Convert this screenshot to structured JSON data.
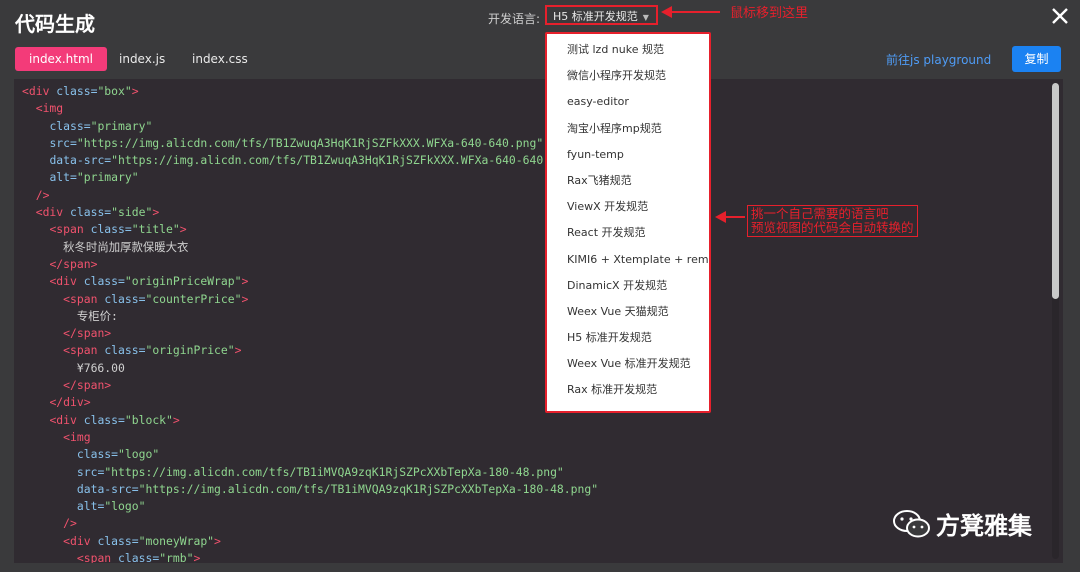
{
  "header": {
    "title": "代码生成",
    "lang_label": "开发语言:",
    "lang_selected": "H5 标准开发规范"
  },
  "tabs": [
    {
      "label": "index.html",
      "active": true
    },
    {
      "label": "index.js",
      "active": false
    },
    {
      "label": "index.css",
      "active": false
    }
  ],
  "toolbar": {
    "playground_label": "前往js playground",
    "copy_label": "复制"
  },
  "dropdown": {
    "options": [
      "测试 lzd nuke 规范",
      "微信小程序开发规范",
      "easy-editor",
      "淘宝小程序mp规范",
      "fyun-temp",
      "Rax飞猪规范",
      "ViewX 开发规范",
      "React 开发规范",
      "KIMI6 + Xtemplate + rem",
      "DinamicX 开发规范",
      "Weex Vue 天猫规范",
      "H5 标准开发规范",
      "Weex Vue 标准开发规范",
      "Rax 标准开发规范"
    ]
  },
  "annotations": {
    "hover_note": "鼠标移到这里",
    "choose_note_line1": "挑一个自己需要的语言吧",
    "choose_note_line2": "预览视图的代码会自动转换的"
  },
  "watermark": {
    "text": "方凳雅集"
  },
  "code_lines": [
    [
      [
        "tg",
        "<div "
      ],
      [
        "at",
        "class="
      ],
      [
        "st",
        "\"box\""
      ],
      [
        "tg",
        ">"
      ]
    ],
    [
      [
        "tx",
        "  "
      ],
      [
        "tg",
        "<img"
      ]
    ],
    [
      [
        "tx",
        "    "
      ],
      [
        "at",
        "class="
      ],
      [
        "st",
        "\"primary\""
      ]
    ],
    [
      [
        "tx",
        "    "
      ],
      [
        "at",
        "src="
      ],
      [
        "st",
        "\"https://img.alicdn.com/tfs/TB1ZwuqA3HqK1RjSZFkXXX.WFXa-640-640.png\""
      ]
    ],
    [
      [
        "tx",
        "    "
      ],
      [
        "at",
        "data-src="
      ],
      [
        "st",
        "\"https://img.alicdn.com/tfs/TB1ZwuqA3HqK1RjSZFkXXX.WFXa-640-640.png\""
      ]
    ],
    [
      [
        "tx",
        "    "
      ],
      [
        "at",
        "alt="
      ],
      [
        "st",
        "\"primary\""
      ]
    ],
    [
      [
        "tx",
        "  "
      ],
      [
        "tg",
        "/>"
      ]
    ],
    [
      [
        "tx",
        "  "
      ],
      [
        "tg",
        "<div "
      ],
      [
        "at",
        "class="
      ],
      [
        "st",
        "\"side\""
      ],
      [
        "tg",
        ">"
      ]
    ],
    [
      [
        "tx",
        "    "
      ],
      [
        "tg",
        "<span "
      ],
      [
        "at",
        "class="
      ],
      [
        "st",
        "\"title\""
      ],
      [
        "tg",
        ">"
      ]
    ],
    [
      [
        "tx",
        "      秋冬时尚加厚款保暖大衣"
      ]
    ],
    [
      [
        "tx",
        "    "
      ],
      [
        "tg",
        "</span>"
      ]
    ],
    [
      [
        "tx",
        "    "
      ],
      [
        "tg",
        "<div "
      ],
      [
        "at",
        "class="
      ],
      [
        "st",
        "\"originPriceWrap\""
      ],
      [
        "tg",
        ">"
      ]
    ],
    [
      [
        "tx",
        "      "
      ],
      [
        "tg",
        "<span "
      ],
      [
        "at",
        "class="
      ],
      [
        "st",
        "\"counterPrice\""
      ],
      [
        "tg",
        ">"
      ]
    ],
    [
      [
        "tx",
        "        专柜价:"
      ]
    ],
    [
      [
        "tx",
        "      "
      ],
      [
        "tg",
        "</span>"
      ]
    ],
    [
      [
        "tx",
        "      "
      ],
      [
        "tg",
        "<span "
      ],
      [
        "at",
        "class="
      ],
      [
        "st",
        "\"originPrice\""
      ],
      [
        "tg",
        ">"
      ]
    ],
    [
      [
        "tx",
        "        ¥766.00"
      ]
    ],
    [
      [
        "tx",
        "      "
      ],
      [
        "tg",
        "</span>"
      ]
    ],
    [
      [
        "tx",
        "    "
      ],
      [
        "tg",
        "</div>"
      ]
    ],
    [
      [
        "tx",
        "    "
      ],
      [
        "tg",
        "<div "
      ],
      [
        "at",
        "class="
      ],
      [
        "st",
        "\"block\""
      ],
      [
        "tg",
        ">"
      ]
    ],
    [
      [
        "tx",
        "      "
      ],
      [
        "tg",
        "<img"
      ]
    ],
    [
      [
        "tx",
        "        "
      ],
      [
        "at",
        "class="
      ],
      [
        "st",
        "\"logo\""
      ]
    ],
    [
      [
        "tx",
        "        "
      ],
      [
        "at",
        "src="
      ],
      [
        "st",
        "\"https://img.alicdn.com/tfs/TB1iMVQA9zqK1RjSZPcXXbTepXa-180-48.png\""
      ]
    ],
    [
      [
        "tx",
        "        "
      ],
      [
        "at",
        "data-src="
      ],
      [
        "st",
        "\"https://img.alicdn.com/tfs/TB1iMVQA9zqK1RjSZPcXXbTepXa-180-48.png\""
      ]
    ],
    [
      [
        "tx",
        "        "
      ],
      [
        "at",
        "alt="
      ],
      [
        "st",
        "\"logo\""
      ]
    ],
    [
      [
        "tx",
        "      "
      ],
      [
        "tg",
        "/>"
      ]
    ],
    [
      [
        "tx",
        "      "
      ],
      [
        "tg",
        "<div "
      ],
      [
        "at",
        "class="
      ],
      [
        "st",
        "\"moneyWrap\""
      ],
      [
        "tg",
        ">"
      ]
    ],
    [
      [
        "tx",
        "        "
      ],
      [
        "tg",
        "<span "
      ],
      [
        "at",
        "class="
      ],
      [
        "st",
        "\"rmb\""
      ],
      [
        "tg",
        ">"
      ]
    ]
  ],
  "colors": {
    "background": "#3a3a3c",
    "editor_bg": "#302b31",
    "active_tab": "#f33b79",
    "copy_button": "#1b82f2",
    "link": "#4f9cf6",
    "annotation_red": "#e6202c",
    "code_tag": "#f0526d",
    "code_attr": "#88c0ea",
    "code_string": "#8fd68f"
  }
}
